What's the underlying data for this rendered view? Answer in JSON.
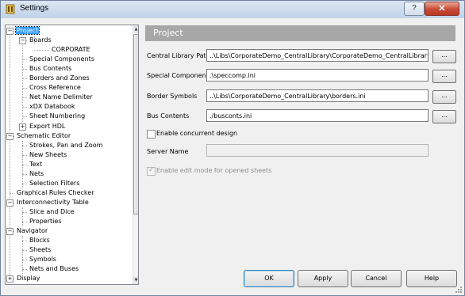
{
  "window": {
    "title": "Settings"
  },
  "tree": {
    "items": [
      {
        "label": "Project",
        "name": "tree-item-project",
        "selected": true
      },
      {
        "label": "Boards",
        "name": "tree-item-boards"
      },
      {
        "label": "CORPORATE",
        "name": "tree-item-corporate"
      },
      {
        "label": "Special Components",
        "name": "tree-item-special-components"
      },
      {
        "label": "Bus Contents",
        "name": "tree-item-bus-contents"
      },
      {
        "label": "Borders and Zones",
        "name": "tree-item-borders-and-zones"
      },
      {
        "label": "Cross Reference",
        "name": "tree-item-cross-reference"
      },
      {
        "label": "Net Name Delimiter",
        "name": "tree-item-net-name-delimiter"
      },
      {
        "label": "xDX Databook",
        "name": "tree-item-xdx-databook"
      },
      {
        "label": "Sheet Numbering",
        "name": "tree-item-sheet-numbering"
      },
      {
        "label": "Export HDL",
        "name": "tree-item-export-hdl"
      },
      {
        "label": "Schematic Editor",
        "name": "tree-item-schematic-editor"
      },
      {
        "label": "Strokes, Pan and Zoom",
        "name": "tree-item-strokes-pan-zoom"
      },
      {
        "label": "New Sheets",
        "name": "tree-item-new-sheets"
      },
      {
        "label": "Text",
        "name": "tree-item-text"
      },
      {
        "label": "Nets",
        "name": "tree-item-nets"
      },
      {
        "label": "Selection Filters",
        "name": "tree-item-selection-filters"
      },
      {
        "label": "Graphical Rules Checker",
        "name": "tree-item-graphical-rules-checker"
      },
      {
        "label": "Interconnectivity Table",
        "name": "tree-item-interconnectivity-table"
      },
      {
        "label": "Slice and Dice",
        "name": "tree-item-slice-and-dice"
      },
      {
        "label": "Properties",
        "name": "tree-item-properties"
      },
      {
        "label": "Navigator",
        "name": "tree-item-navigator"
      },
      {
        "label": "Blocks",
        "name": "tree-item-blocks"
      },
      {
        "label": "Sheets",
        "name": "tree-item-sheets"
      },
      {
        "label": "Symbols",
        "name": "tree-item-symbols"
      },
      {
        "label": "Nets and Buses",
        "name": "tree-item-nets-and-buses"
      },
      {
        "label": "Display",
        "name": "tree-item-display"
      }
    ]
  },
  "panel": {
    "header": "Project",
    "central_library_path": {
      "label": "Central Library Path",
      "value": "..\\Libs\\CorporateDemo_CentralLibrary\\CorporateDemo_CentralLibrary."
    },
    "special_components": {
      "label": "Special Components",
      "value": ".\\speccomp.ini"
    },
    "border_symbols": {
      "label": "Border Symbols",
      "value": "..\\Libs\\CorporateDemo_CentralLibrary\\borders.ini"
    },
    "bus_contents": {
      "label": "Bus Contents",
      "value": "./busconts.ini"
    },
    "browse_label": "...",
    "concurrent_design": {
      "label": "Enable concurrent design",
      "checked": false
    },
    "server_name": {
      "label": "Server Name",
      "value": ""
    },
    "edit_mode": {
      "label": "Enable edit mode for opened sheets",
      "checked": true
    }
  },
  "buttons": {
    "ok": "OK",
    "apply": "Apply",
    "cancel": "Cancel",
    "help": "Help"
  }
}
